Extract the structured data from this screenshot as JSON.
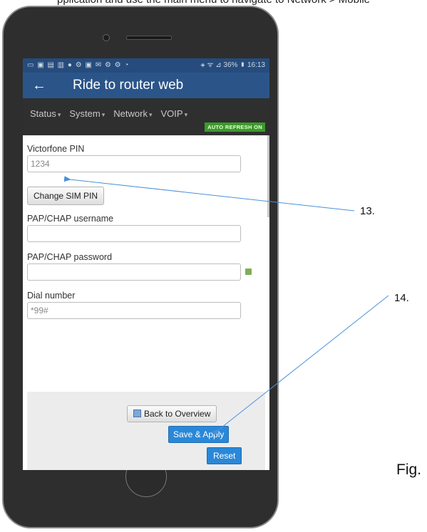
{
  "doc": {
    "top_text": "pplication and use the main menu to navigate to Network > Mobile",
    "callout_13": "13.",
    "callout_14": "14.",
    "fig_label": "Fig."
  },
  "status_bar": {
    "left_icons": "▭ ▣ ▤ ▥ ● ⚙ ▣ ✉ ⚙ ⚙ ◔",
    "right_text": "⚹ ᯤ ⊿ 36% ▮ 16:13"
  },
  "appbar": {
    "back_icon": "←",
    "title": "Ride to router web"
  },
  "menu": {
    "items": [
      {
        "label": "Status"
      },
      {
        "label": "System"
      },
      {
        "label": "Network"
      },
      {
        "label": "VOIP"
      }
    ],
    "caret": "▾",
    "auto_refresh": "AUTO REFRESH ON"
  },
  "form": {
    "pin_label": "Victorfone PIN",
    "pin_value": "1234",
    "change_sim_pin": "Change SIM PIN",
    "pap_user_label": "PAP/CHAP username",
    "pap_user_value": "",
    "pap_pass_label": "PAP/CHAP password",
    "pap_pass_value": "",
    "dial_label": "Dial number",
    "dial_value": "*99#"
  },
  "footer": {
    "back_to_overview": "Back to Overview",
    "save_apply": "Save & Apply",
    "reset": "Reset"
  },
  "colors": {
    "appbar": "#2b5589",
    "menu_bg": "#2f2f2f",
    "auto_refresh": "#3c9a2b",
    "primary_button": "#2a88d8",
    "annotation_line": "#4a90d9"
  }
}
